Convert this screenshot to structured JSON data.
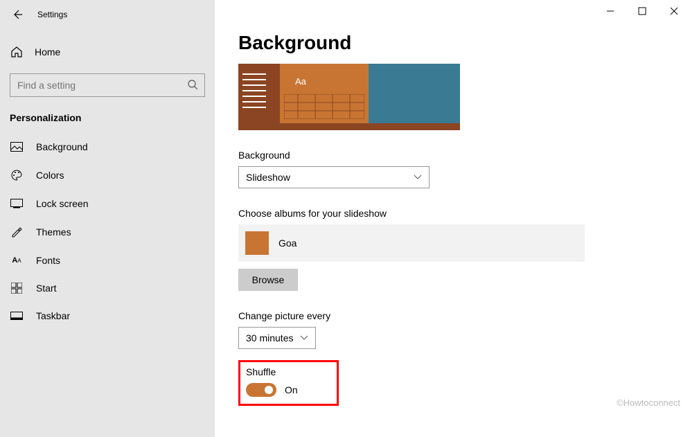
{
  "app": {
    "title": "Settings"
  },
  "sidebar": {
    "home": "Home",
    "search_placeholder": "Find a setting",
    "category": "Personalization",
    "items": [
      {
        "label": "Background"
      },
      {
        "label": "Colors"
      },
      {
        "label": "Lock screen"
      },
      {
        "label": "Themes"
      },
      {
        "label": "Fonts"
      },
      {
        "label": "Start"
      },
      {
        "label": "Taskbar"
      }
    ]
  },
  "main": {
    "title": "Background",
    "bg_label": "Background",
    "bg_value": "Slideshow",
    "albums_label": "Choose albums for your slideshow",
    "album_name": "Goa",
    "browse": "Browse",
    "interval_label": "Change picture every",
    "interval_value": "30 minutes",
    "shuffle_label": "Shuffle",
    "shuffle_state": "On",
    "preview_aa": "Aa"
  },
  "watermark": "©Howtoconnect"
}
